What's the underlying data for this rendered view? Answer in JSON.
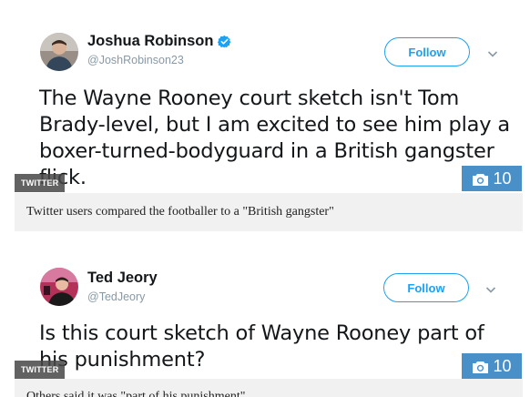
{
  "tweets": [
    {
      "name": "Joshua Robinson",
      "handle": "@JoshRobinson23",
      "follow_label": "Follow",
      "text": "The Wayne Rooney court sketch isn't Tom Brady-level, but I am excited to see him play a boxer-turned-bodyguard in a British gangster flick.",
      "verified": true,
      "source_tag": "TWITTER",
      "photo_count": "10",
      "caption": "Twitter users compared the footballer to a \"British gangster\""
    },
    {
      "name": "Ted Jeory",
      "handle": "@TedJeory",
      "follow_label": "Follow",
      "text": "Is this court sketch of Wayne Rooney part of his punishment?",
      "verified": false,
      "source_tag": "TWITTER",
      "photo_count": "10",
      "caption": "Others said it was \"part of his punishment\""
    }
  ],
  "colors": {
    "twitter_blue": "#1da1f2",
    "photo_badge": "#4a90c8",
    "caption_bg": "#f1f1f1",
    "handle_grey": "#8899a6"
  },
  "icons": {
    "verified": "verified-badge-icon",
    "chevron": "chevron-down-icon",
    "camera": "camera-icon"
  }
}
